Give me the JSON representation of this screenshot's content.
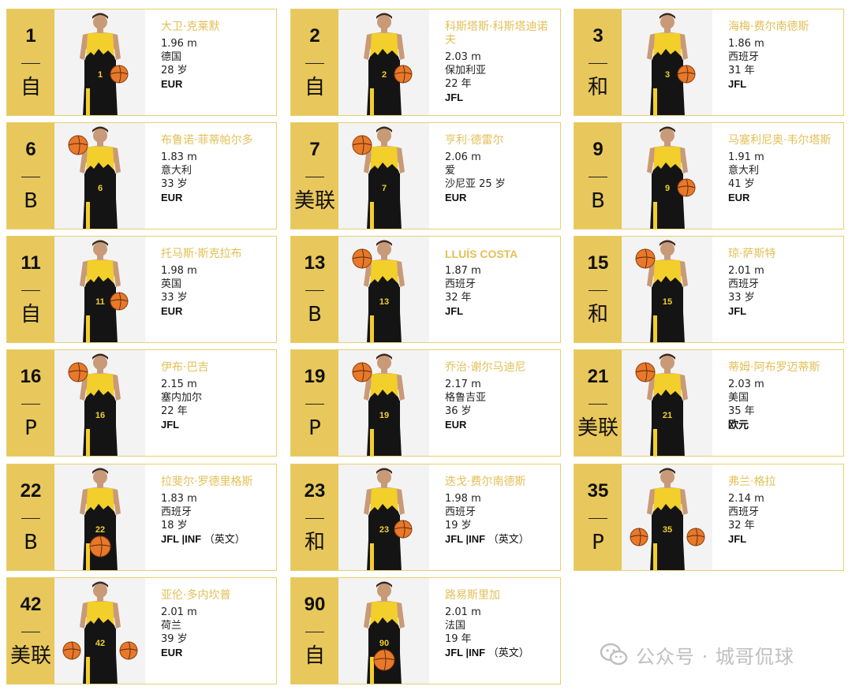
{
  "players": [
    {
      "number": "1",
      "position": "自",
      "name": "大卫·克莱默",
      "height": "1.96 m",
      "country": "德国",
      "age": "28 岁",
      "league": "EUR",
      "league_note": "",
      "ball": "right"
    },
    {
      "number": "2",
      "position": "自",
      "name": "科斯塔斯·科斯塔迪诺夫",
      "height": "2.03 m",
      "country": "保加利亚",
      "age": "22 年",
      "league": "JFL",
      "league_note": "",
      "ball": "right"
    },
    {
      "number": "3",
      "position": "和",
      "name": "海梅·费尔南德斯",
      "height": "1.86 m",
      "country": "西班牙",
      "age": "31 年",
      "league": "JFL",
      "league_note": "",
      "ball": "right"
    },
    {
      "number": "6",
      "position": "B",
      "name": "布鲁诺·菲蒂帕尔多",
      "height": "1.83 m",
      "country": "意大利",
      "age": "33 岁",
      "league": "EUR",
      "league_note": "",
      "ball": "left"
    },
    {
      "number": "7",
      "position": "美联",
      "name": "亨利·德雷尔",
      "height": "2.06 m",
      "country": "爱",
      "age": "沙尼亚 25 岁",
      "league": "EUR",
      "league_note": "",
      "ball": "left"
    },
    {
      "number": "9",
      "position": "B",
      "name": "马塞利尼奥·韦尔塔斯",
      "height": "1.91 m",
      "country": "意大利",
      "age": "41 岁",
      "league": "EUR",
      "league_note": "",
      "ball": "right"
    },
    {
      "number": "11",
      "position": "自",
      "name": "托马斯·斯克拉布",
      "height": "1.98 m",
      "country": "英国",
      "age": "33 岁",
      "league": "EUR",
      "league_note": "",
      "ball": "right"
    },
    {
      "number": "13",
      "position": "B",
      "name": "LLUÍS COSTA",
      "height": "1.87 m",
      "country": "西班牙",
      "age": "32 年",
      "league": "JFL",
      "league_note": "",
      "ball": "left"
    },
    {
      "number": "15",
      "position": "和",
      "name": "琼·萨斯特",
      "height": "2.01 m",
      "country": "西班牙",
      "age": "33 岁",
      "league": "JFL",
      "league_note": "",
      "ball": "left"
    },
    {
      "number": "16",
      "position": "P",
      "name": "伊布·巴吉",
      "height": "2.15 m",
      "country": "塞内加尔",
      "age": "22 年",
      "league": "JFL",
      "league_note": "",
      "ball": "left"
    },
    {
      "number": "19",
      "position": "P",
      "name": "乔治·谢尔马迪尼",
      "height": "2.17 m",
      "country": "格鲁吉亚",
      "age": "36 岁",
      "league": "EUR",
      "league_note": "",
      "ball": "left"
    },
    {
      "number": "21",
      "position": "美联",
      "name": "蒂姆·阿布罗迈蒂斯",
      "height": "2.03 m",
      "country": "美国",
      "age": "35 年",
      "league": "欧元",
      "league_note": "",
      "ball": "left"
    },
    {
      "number": "22",
      "position": "B",
      "name": "拉斐尔·罗德里格斯",
      "height": "1.83 m",
      "country": "西班牙",
      "age": "18 岁",
      "league": "JFL |INF",
      "league_note": "（英文）",
      "ball": "center"
    },
    {
      "number": "23",
      "position": "和",
      "name": "迭戈·费尔南德斯",
      "height": "1.98 m",
      "country": "西班牙",
      "age": "19 岁",
      "league": "JFL |INF",
      "league_note": "（英文）",
      "ball": "right"
    },
    {
      "number": "35",
      "position": "P",
      "name": "弗兰·格拉",
      "height": "2.14 m",
      "country": "西班牙",
      "age": "32 年",
      "league": "JFL",
      "league_note": "",
      "ball": "both"
    },
    {
      "number": "42",
      "position": "美联",
      "name": "亚伦·多内坎普",
      "height": "2.01 m",
      "country": "荷兰",
      "age": "39 岁",
      "league": "EUR",
      "league_note": "",
      "ball": "both"
    },
    {
      "number": "90",
      "position": "自",
      "name": "路易斯里加",
      "height": "2.01 m",
      "country": "法国",
      "age": "19 年",
      "league": "JFL |INF",
      "league_note": "（英文）",
      "ball": "center"
    }
  ],
  "watermark": {
    "text": "公众号 · 城哥侃球",
    "icon": "wechat-icon"
  },
  "colors": {
    "accent": "#e8c75c",
    "name": "#e3bf55",
    "border": "#e8cf6e",
    "jersey_yellow": "#f2cf2a",
    "jersey_black": "#141414"
  }
}
